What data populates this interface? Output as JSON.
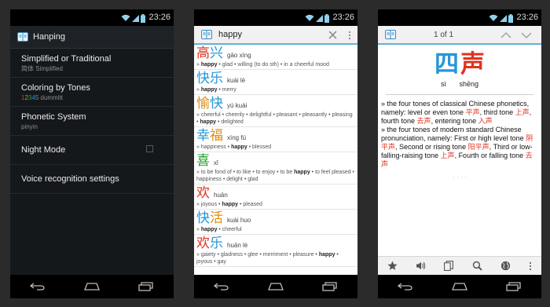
{
  "status": {
    "time": "23:26"
  },
  "settings_screen": {
    "title": "Hanping",
    "items": [
      {
        "title": "Simplified or Traditional",
        "summary": "简体 Simplified"
      },
      {
        "title": "Coloring by Tones",
        "summary_digits": [
          "1",
          "2",
          "3",
          "4",
          "5"
        ],
        "summary_rest": " dummitt"
      },
      {
        "title": "Phonetic System",
        "summary": "pinyin"
      },
      {
        "title": "Night Mode",
        "summary": ""
      },
      {
        "title": "Voice recognition settings",
        "summary": ""
      }
    ]
  },
  "search_screen": {
    "query": "happy",
    "entries": [
      {
        "hanzi": [
          {
            "c": "高",
            "tone": 1
          },
          {
            "c": "兴",
            "tone": 4
          }
        ],
        "pinyin": "gāo xìng",
        "defs_before": "» ",
        "defs_bold": "happy",
        "defs_after": " • glad • willing (to do sth) • in a cheerful mood"
      },
      {
        "hanzi": [
          {
            "c": "快",
            "tone": 4
          },
          {
            "c": "乐",
            "tone": 4
          }
        ],
        "pinyin": "kuài lè",
        "defs_before": "» ",
        "defs_bold": "happy",
        "defs_after": " • merry"
      },
      {
        "hanzi": [
          {
            "c": "愉",
            "tone": 2
          },
          {
            "c": "快",
            "tone": 4
          }
        ],
        "pinyin": "yú kuài",
        "defs_before": "» cheerful • cheerily • delightful • pleasant • pleasantly • pleasing • ",
        "defs_bold": "happy",
        "defs_after": " • delighted"
      },
      {
        "hanzi": [
          {
            "c": "幸",
            "tone": 4
          },
          {
            "c": "福",
            "tone": 2
          }
        ],
        "pinyin": "xìng fú",
        "defs_before": "» happiness • ",
        "defs_bold": "happy",
        "defs_after": " • blessed"
      },
      {
        "hanzi": [
          {
            "c": "喜",
            "tone": 3
          }
        ],
        "pinyin": "xǐ",
        "defs_before": "» to be fond of • to like • to enjoy • to be ",
        "defs_bold": "happy",
        "defs_after": " • to feel pleased • happiness • delight • glad"
      },
      {
        "hanzi": [
          {
            "c": "欢",
            "tone": 1
          }
        ],
        "pinyin": "huān",
        "defs_before": "» joyous • ",
        "defs_bold": "happy",
        "defs_after": " • pleased"
      },
      {
        "hanzi": [
          {
            "c": "快",
            "tone": 4
          },
          {
            "c": "活",
            "tone": 2
          }
        ],
        "pinyin": "kuài huo",
        "defs_before": "» ",
        "defs_bold": "happy",
        "defs_after": " • cheerful"
      },
      {
        "hanzi": [
          {
            "c": "欢",
            "tone": 1
          },
          {
            "c": "乐",
            "tone": 4
          }
        ],
        "pinyin": "huān lè",
        "defs_before": "» gaiety • gladness • glee • merriment • pleasure • ",
        "defs_bold": "happy",
        "defs_after": " • joyous • gay"
      }
    ]
  },
  "detail_screen": {
    "pager": "1 of 1",
    "hanzi": [
      {
        "c": "四",
        "tone": 4
      },
      {
        "c": "声",
        "tone": 1
      }
    ],
    "pinyin": "sì shēng",
    "def1": [
      {
        "t": "» the four tones of classical Chinese phonetics, namely: level or even tone "
      },
      {
        "t": "平声",
        "red": true
      },
      {
        "t": ", third tone "
      },
      {
        "t": "上声",
        "red": true
      },
      {
        "t": ", fourth tone "
      },
      {
        "t": "去声",
        "red": true
      },
      {
        "t": ", entering tone "
      },
      {
        "t": "入声",
        "red": true
      }
    ],
    "def2": [
      {
        "t": "» the four tones of modern standard Chinese pronunciation, namely: First or high level tone "
      },
      {
        "t": "阴平声",
        "red": true
      },
      {
        "t": ", Second or rising tone "
      },
      {
        "t": "阳平声",
        "red": true
      },
      {
        "t": ", Third or low-falling-raising tone "
      },
      {
        "t": "上声",
        "red": true
      },
      {
        "t": ", Fourth or falling tone "
      },
      {
        "t": "去声",
        "red": true
      }
    ],
    "ellipsis": "· · · ·"
  },
  "colors": {
    "tone1": "#e0321e",
    "tone2": "#e08a0c",
    "tone3": "#27a036",
    "tone4": "#2596d8",
    "tone5": "#888888",
    "accent": "#5fb2d9"
  },
  "icons": [
    "wifi-icon",
    "signal-icon",
    "battery-icon",
    "dictionary-app-icon",
    "close-icon",
    "overflow-menu-icon",
    "chevron-up-icon",
    "chevron-down-icon",
    "star-icon",
    "speaker-icon",
    "copy-icon",
    "search-icon",
    "globe-icon",
    "back-nav-icon",
    "home-nav-icon",
    "recents-nav-icon"
  ]
}
